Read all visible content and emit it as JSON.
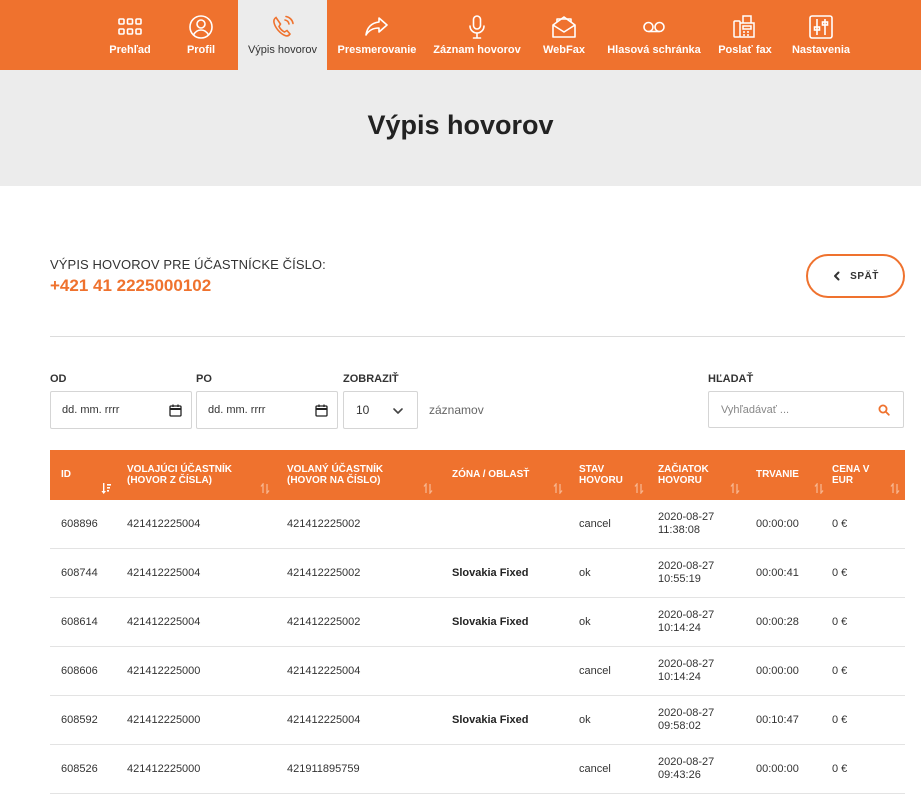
{
  "nav": {
    "items": [
      {
        "label": "Prehľad",
        "icon": "grid-icon",
        "active": false
      },
      {
        "label": "Profil",
        "icon": "user-icon",
        "active": false
      },
      {
        "label": "Výpis hovorov",
        "icon": "phone-calling-icon",
        "active": true
      },
      {
        "label": "Presmerovanie",
        "icon": "forward-arrow-icon",
        "active": false
      },
      {
        "label": "Záznam hovorov",
        "icon": "microphone-icon",
        "active": false
      },
      {
        "label": "WebFax",
        "icon": "open-envelope-icon",
        "active": false
      },
      {
        "label": "Hlasová schránka",
        "icon": "voicemail-icon",
        "active": false
      },
      {
        "label": "Poslať fax",
        "icon": "fax-icon",
        "active": false
      },
      {
        "label": "Nastavenia",
        "icon": "sliders-icon",
        "active": false
      }
    ]
  },
  "page": {
    "title": "Výpis hovorov"
  },
  "subscriber": {
    "label": "VÝPIS HOVOROV PRE ÚČASTNÍCKE ČÍSLO:",
    "number": "+421 41 2225000102",
    "back_label": "SPÄŤ"
  },
  "filters": {
    "from_label": "OD",
    "from_placeholder": "dd. mm. rrrr",
    "to_label": "PO",
    "to_placeholder": "dd. mm. rrrr",
    "show_label": "ZOBRAZIŤ",
    "show_value": "10",
    "records_text": "záznamov",
    "search_label": "HĽADAŤ",
    "search_placeholder": "Vyhľadávať ..."
  },
  "table": {
    "columns": [
      {
        "line1": "ID",
        "line2": ""
      },
      {
        "line1": "VOLAJÚCI ÚČASTNÍK",
        "line2": "(HOVOR Z ČÍSLA)"
      },
      {
        "line1": "VOLANÝ ÚČASTNÍK",
        "line2": "(HOVOR NA ČÍSLO)"
      },
      {
        "line1": "ZÓNA / OBLASŤ",
        "line2": ""
      },
      {
        "line1": "STAV",
        "line2": "HOVORU"
      },
      {
        "line1": "ZAČIATOK",
        "line2": "HOVORU"
      },
      {
        "line1": "TRVANIE",
        "line2": ""
      },
      {
        "line1": "CENA V",
        "line2": "EUR"
      }
    ],
    "rows": [
      {
        "id": "608896",
        "caller": "421412225004",
        "callee": "421412225002",
        "zone": "",
        "status": "cancel",
        "date": "2020-08-27",
        "time": "11:38:08",
        "duration": "00:00:00",
        "price": "0 €"
      },
      {
        "id": "608744",
        "caller": "421412225004",
        "callee": "421412225002",
        "zone": "Slovakia Fixed",
        "status": "ok",
        "date": "2020-08-27",
        "time": "10:55:19",
        "duration": "00:00:41",
        "price": "0 €"
      },
      {
        "id": "608614",
        "caller": "421412225004",
        "callee": "421412225002",
        "zone": "Slovakia Fixed",
        "status": "ok",
        "date": "2020-08-27",
        "time": "10:14:24",
        "duration": "00:00:28",
        "price": "0 €"
      },
      {
        "id": "608606",
        "caller": "421412225000",
        "callee": "421412225004",
        "zone": "",
        "status": "cancel",
        "date": "2020-08-27",
        "time": "10:14:24",
        "duration": "00:00:00",
        "price": "0 €"
      },
      {
        "id": "608592",
        "caller": "421412225000",
        "callee": "421412225004",
        "zone": "Slovakia Fixed",
        "status": "ok",
        "date": "2020-08-27",
        "time": "09:58:02",
        "duration": "00:10:47",
        "price": "0 €"
      },
      {
        "id": "608526",
        "caller": "421412225000",
        "callee": "421911895759",
        "zone": "",
        "status": "cancel",
        "date": "2020-08-27",
        "time": "09:43:26",
        "duration": "00:00:00",
        "price": "0 €"
      }
    ]
  },
  "colors": {
    "accent": "#ef722e",
    "hero_bg": "#ececec"
  }
}
